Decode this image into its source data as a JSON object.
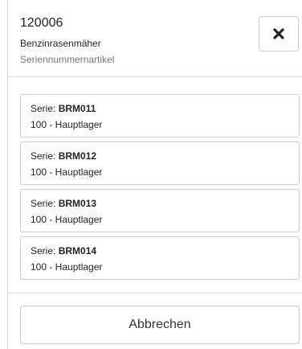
{
  "header": {
    "item_number": "120006",
    "item_name": "Benzinrasenmäher",
    "item_type": "Seriennummernartikel",
    "close_icon": "close-icon"
  },
  "serials": [
    {
      "prefix": "Serie:",
      "serial": "BRM011",
      "location": "100 - Hauptlager"
    },
    {
      "prefix": "Serie:",
      "serial": "BRM012",
      "location": "100 - Hauptlager"
    },
    {
      "prefix": "Serie:",
      "serial": "BRM013",
      "location": "100 - Hauptlager"
    },
    {
      "prefix": "Serie:",
      "serial": "BRM014",
      "location": "100 - Hauptlager"
    }
  ],
  "footer": {
    "cancel_label": "Abbrechen"
  }
}
